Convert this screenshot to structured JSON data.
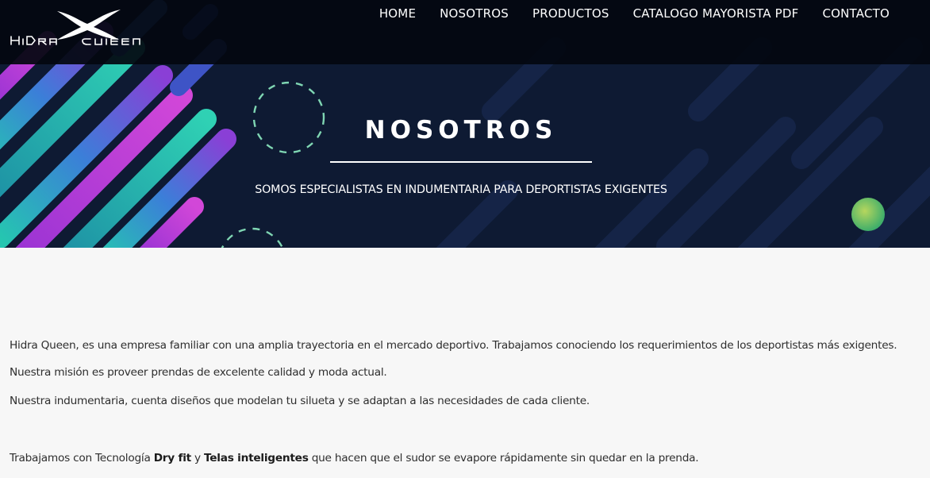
{
  "header": {
    "logo_text": "Hidra Queen",
    "nav": [
      {
        "label": "HOME"
      },
      {
        "label": "NOSOTROS"
      },
      {
        "label": "PRODUCTOS"
      },
      {
        "label": "CATALOGO MAYORISTA PDF"
      },
      {
        "label": "CONTACTO"
      }
    ]
  },
  "hero": {
    "title": "NOSOTROS",
    "subtitle": "SOMOS ESPECIALISTAS EN INDUMENTARIA PARA DEPORTISTAS EXIGENTES"
  },
  "content": {
    "paragraphs": [
      "Hidra Queen, es una empresa familiar con una amplia trayectoria en el mercado deportivo. Trabajamos conociendo los requerimientos de los deportistas más exigentes.",
      "Nuestra misión es proveer prendas de excelente calidad y moda actual.",
      "Nuestra indumentaria, cuenta diseños que modelan tu silueta y se adaptan a las necesidades de cada cliente."
    ],
    "technology": {
      "prefix": "Trabajamos con Tecnología ",
      "bold1": "Dry fit",
      "middle": " y ",
      "bold2": "Telas inteligentes",
      "suffix": " que hacen que el sudor se evapore rápidamente sin quedar en la prenda."
    }
  },
  "colors": {
    "hero_background": "#0e1a33",
    "header_bar": "#030810",
    "stripe_teal": "#1fb8a8",
    "stripe_purple": "#7b2fc9",
    "stripe_magenta": "#c23bd6",
    "text": "#2e2e2e"
  }
}
